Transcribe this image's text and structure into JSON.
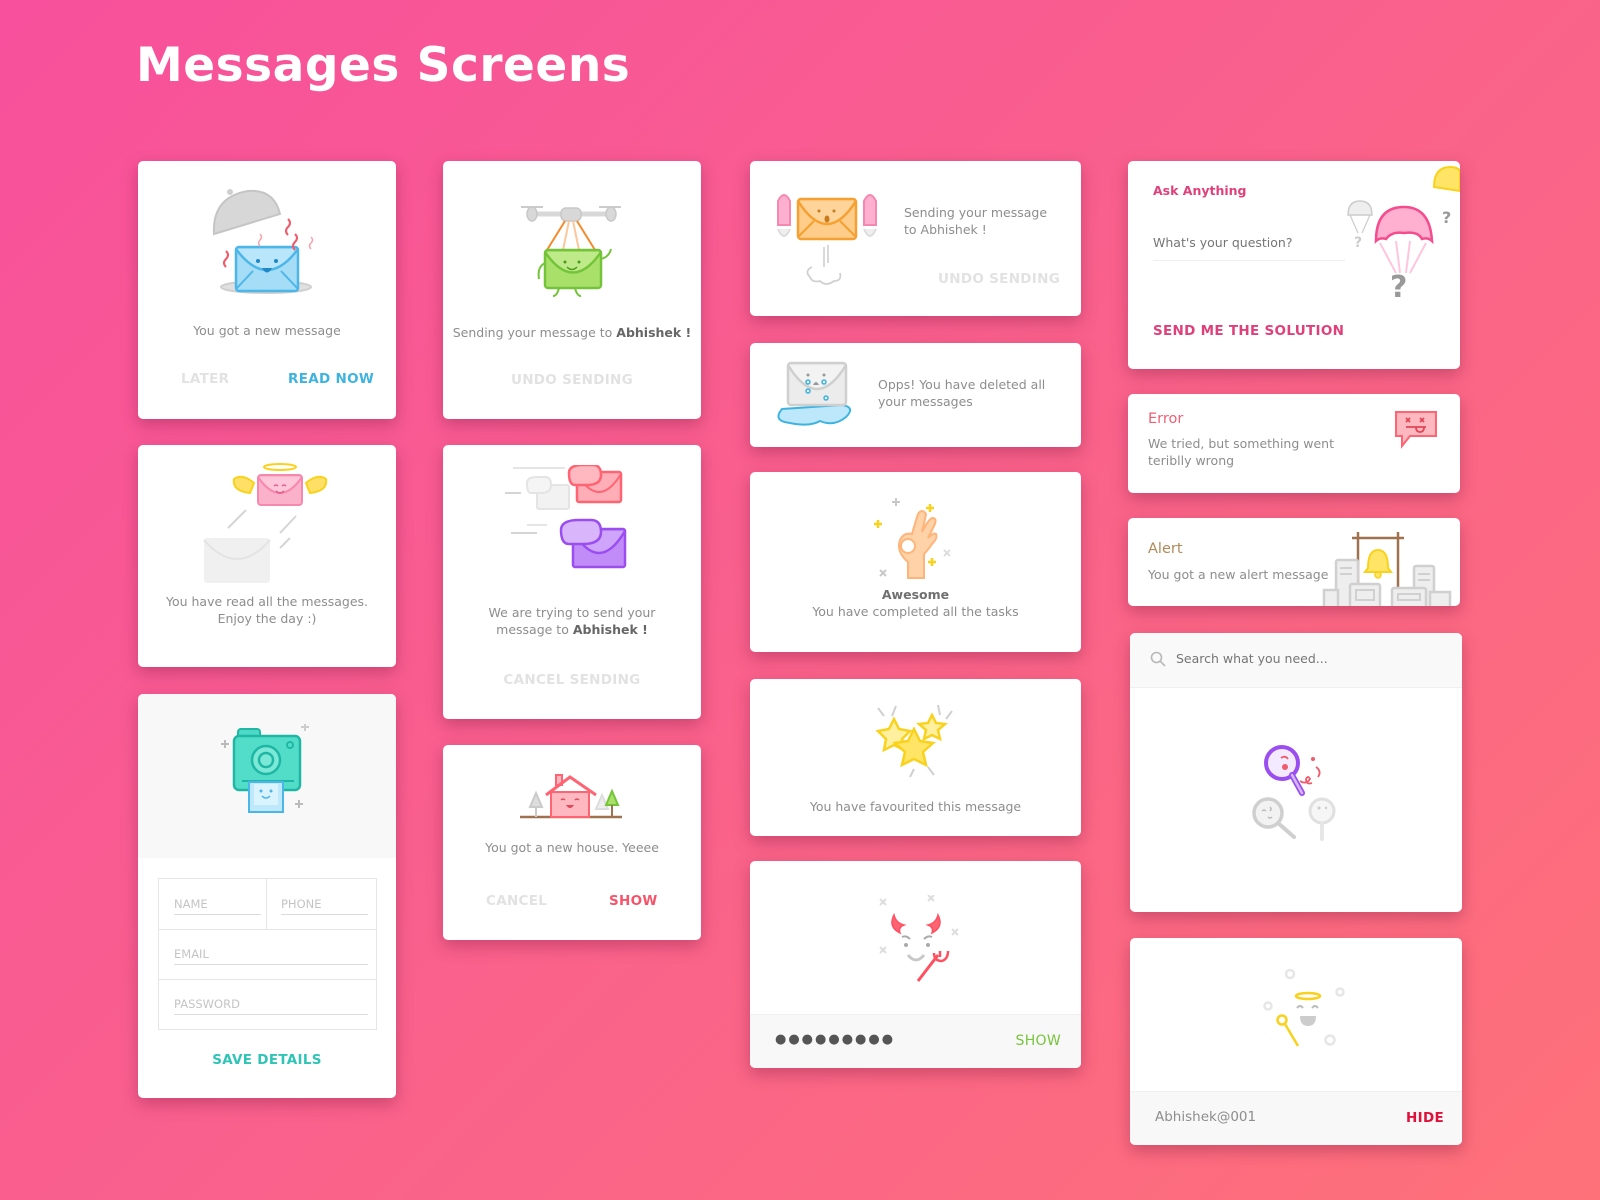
{
  "page": {
    "title": "Messages Screens"
  },
  "colors": {
    "background_start": "#f8509c",
    "background_end": "#fe7179",
    "read_now": "#3fb3e0",
    "save_details": "#2ec4b6",
    "show_red": "#f5546a",
    "ask_pink": "#e0407a",
    "error_red": "#f06072",
    "alert_brown": "#b08a5a",
    "show_green": "#78c43c",
    "hide_red": "#e0103a"
  },
  "cards": {
    "new_message": {
      "illustration": "envelope-on-platter-icon",
      "text": "You got a new message",
      "later_label": "LATER",
      "read_now_label": "READ NOW"
    },
    "drone_sending": {
      "illustration": "drone-envelope-icon",
      "text_prefix": "Sending your message to ",
      "recipient": "Abhishek !",
      "undo_label": "UNDO SENDING"
    },
    "rocket_sending": {
      "illustration": "rocket-envelope-icon",
      "text": "Sending your message to Abhishek !",
      "undo_label": "UNDO SENDING"
    },
    "ask_anything": {
      "heading": "Ask Anything",
      "question_placeholder": "What's your question?",
      "submit_label": "SEND ME THE SOLUTION",
      "illustration": "parachute-question-icon"
    },
    "read_all": {
      "illustration": "angel-envelope-icon",
      "line1": "You have read all the messages.",
      "line2": "Enjoy the day :)"
    },
    "trying_send": {
      "illustration": "flying-envelopes-icon",
      "text_line1": "We are trying to send your",
      "text_line2_prefix": "message to ",
      "recipient": "Abhishek !",
      "cancel_label": "CANCEL SENDING"
    },
    "deleted": {
      "illustration": "crying-envelope-icon",
      "text": "Opps! You have deleted all your messages"
    },
    "error": {
      "heading": "Error",
      "text": "We tried, but something went teriblly wrong",
      "illustration": "error-chat-bubble-icon"
    },
    "awesome": {
      "illustration": "ok-hand-icon",
      "heading": "Awesome",
      "text": "You have completed all the tasks"
    },
    "alert": {
      "heading": "Alert",
      "text": "You got a new alert message",
      "illustration": "bell-city-icon"
    },
    "profile_form": {
      "illustration": "instant-camera-icon",
      "name_placeholder": "NAME",
      "phone_placeholder": "PHONE",
      "email_placeholder": "EMAIL",
      "password_placeholder": "PASSWORD",
      "save_label": "SAVE DETAILS"
    },
    "new_house": {
      "illustration": "happy-house-icon",
      "text": "You got a new house. Yeeee",
      "cancel_label": "CANCEL",
      "show_label": "SHOW"
    },
    "favourited": {
      "illustration": "stars-icon",
      "text": "You have favourited this message"
    },
    "search": {
      "placeholder": "Search what you need...",
      "illustration": "magnifier-characters-icon"
    },
    "password_hidden": {
      "illustration": "devil-face-icon",
      "value": "●●●●●●●●●",
      "show_label": "SHOW"
    },
    "password_shown": {
      "illustration": "angel-face-icon",
      "value": "Abhishek@001",
      "hide_label": "HIDE"
    }
  }
}
